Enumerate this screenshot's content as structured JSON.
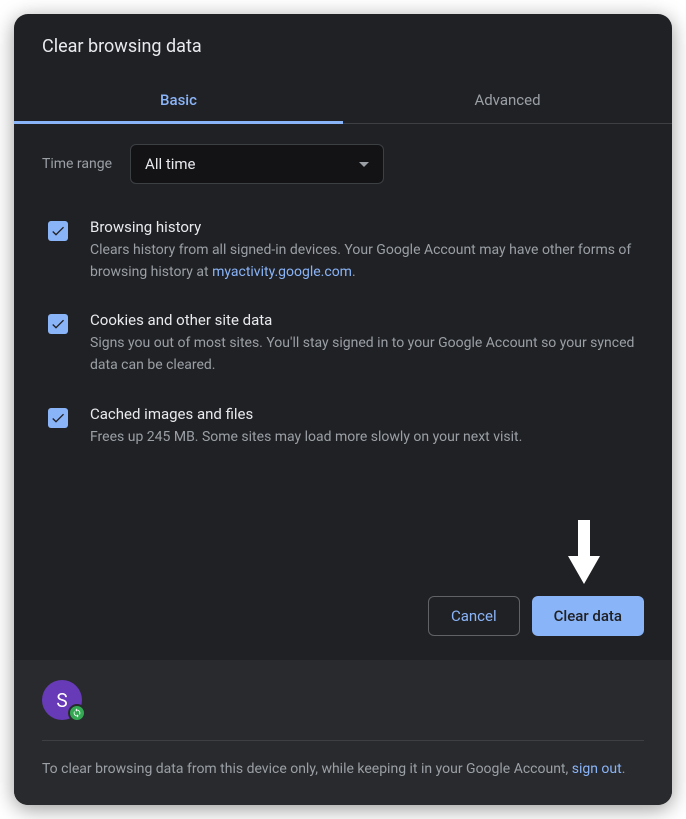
{
  "dialog": {
    "title": "Clear browsing data"
  },
  "tabs": {
    "basic": "Basic",
    "advanced": "Advanced"
  },
  "timeRange": {
    "label": "Time range",
    "value": "All time"
  },
  "options": {
    "browsingHistory": {
      "title": "Browsing history",
      "descPrefix": "Clears history from all signed-in devices. Your Google Account may have other forms of browsing history at ",
      "link": "myactivity.google.com",
      "descSuffix": "."
    },
    "cookies": {
      "title": "Cookies and other site data",
      "desc": "Signs you out of most sites. You'll stay signed in to your Google Account so your synced data can be cleared."
    },
    "cache": {
      "title": "Cached images and files",
      "desc": "Frees up 245 MB. Some sites may load more slowly on your next visit."
    }
  },
  "buttons": {
    "cancel": "Cancel",
    "clearData": "Clear data"
  },
  "avatar": {
    "initial": "S"
  },
  "footer": {
    "textPrefix": "To clear browsing data from this device only, while keeping it in your Google Account, ",
    "link": "sign out",
    "textSuffix": "."
  }
}
